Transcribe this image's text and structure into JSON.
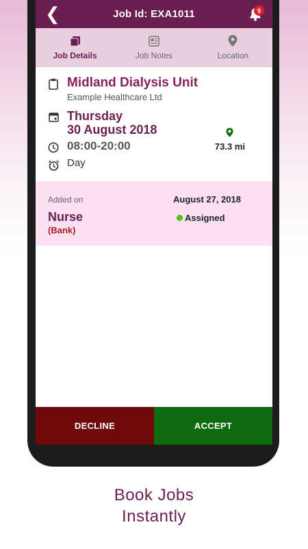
{
  "header": {
    "title": "Job Id: EXA1011",
    "notification_count": "9"
  },
  "tabs": [
    {
      "label": "Job Details",
      "icon": "documents-icon",
      "active": true
    },
    {
      "label": "Job Notes",
      "icon": "notes-icon",
      "active": false
    },
    {
      "label": "Location",
      "icon": "map-pin-icon",
      "active": false
    }
  ],
  "job": {
    "unit": "Midland Dialysis Unit",
    "company": "Example Healthcare Ltd",
    "weekday": "Thursday",
    "date": "30 August 2018",
    "time": "08:00-20:00",
    "shift": "Day",
    "distance": "73.3 mi"
  },
  "details": {
    "added_label": "Added on",
    "added_date": "August 27, 2018",
    "role": "Nurse",
    "role_type": "(Bank)",
    "status": "Assigned"
  },
  "actions": {
    "decline": "DECLINE",
    "accept": "ACCEPT"
  },
  "caption": {
    "line1": "Book Jobs",
    "line2": "Instantly"
  },
  "colors": {
    "primary": "#6b1e50",
    "accent": "#8a1f5f",
    "decline": "#6e0a0a",
    "accept": "#0e6b10",
    "status_dot": "#56c21a"
  }
}
